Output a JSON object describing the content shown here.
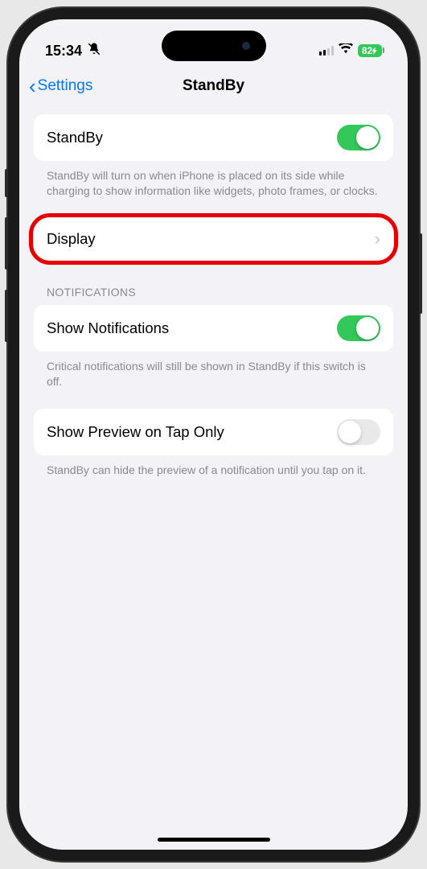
{
  "status": {
    "time": "15:34",
    "battery": "82"
  },
  "nav": {
    "back": "Settings",
    "title": "StandBy"
  },
  "standby": {
    "label": "StandBy",
    "footer": "StandBy will turn on when iPhone is placed on its side while charging to show information like widgets, photo frames, or clocks."
  },
  "display": {
    "label": "Display"
  },
  "notifications": {
    "header": "NOTIFICATIONS",
    "show_label": "Show Notifications",
    "show_footer": "Critical notifications will still be shown in StandBy if this switch is off.",
    "preview_label": "Show Preview on Tap Only",
    "preview_footer": "StandBy can hide the preview of a notification until you tap on it."
  }
}
